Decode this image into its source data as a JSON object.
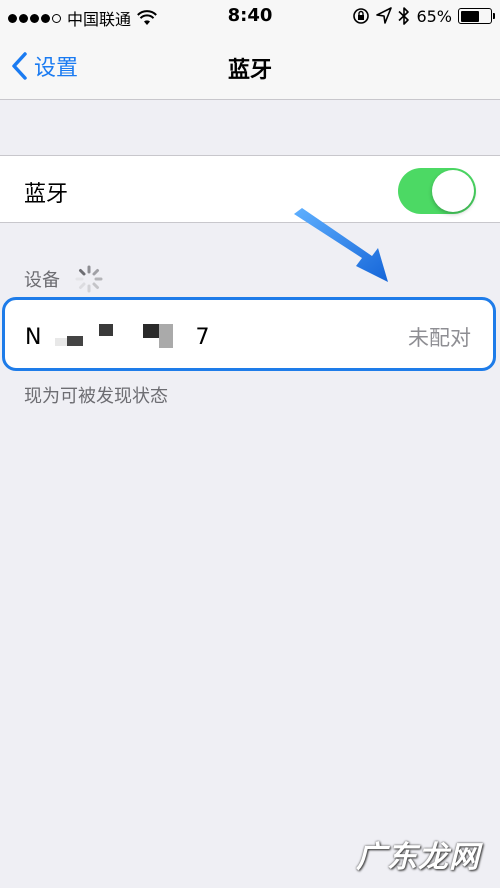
{
  "status_bar": {
    "carrier": "中国联通",
    "time": "8:40",
    "battery_percent": "65%",
    "battery_level": 0.65,
    "signal_bars_filled": 4,
    "signal_bars_total": 5
  },
  "nav": {
    "back_label": "设置",
    "title": "蓝牙"
  },
  "bluetooth": {
    "label": "蓝牙",
    "enabled": true,
    "accent_color": "#4cd964"
  },
  "devices_section": {
    "header": "设备",
    "items": [
      {
        "name_prefix": "N",
        "name_suffix": "7",
        "status": "未配对"
      }
    ]
  },
  "footer_note": "现为可被发现状态",
  "watermark": "广东龙网",
  "colors": {
    "tint": "#1a7bf2",
    "highlight_border": "#1e7ce9",
    "background": "#efeff4"
  }
}
